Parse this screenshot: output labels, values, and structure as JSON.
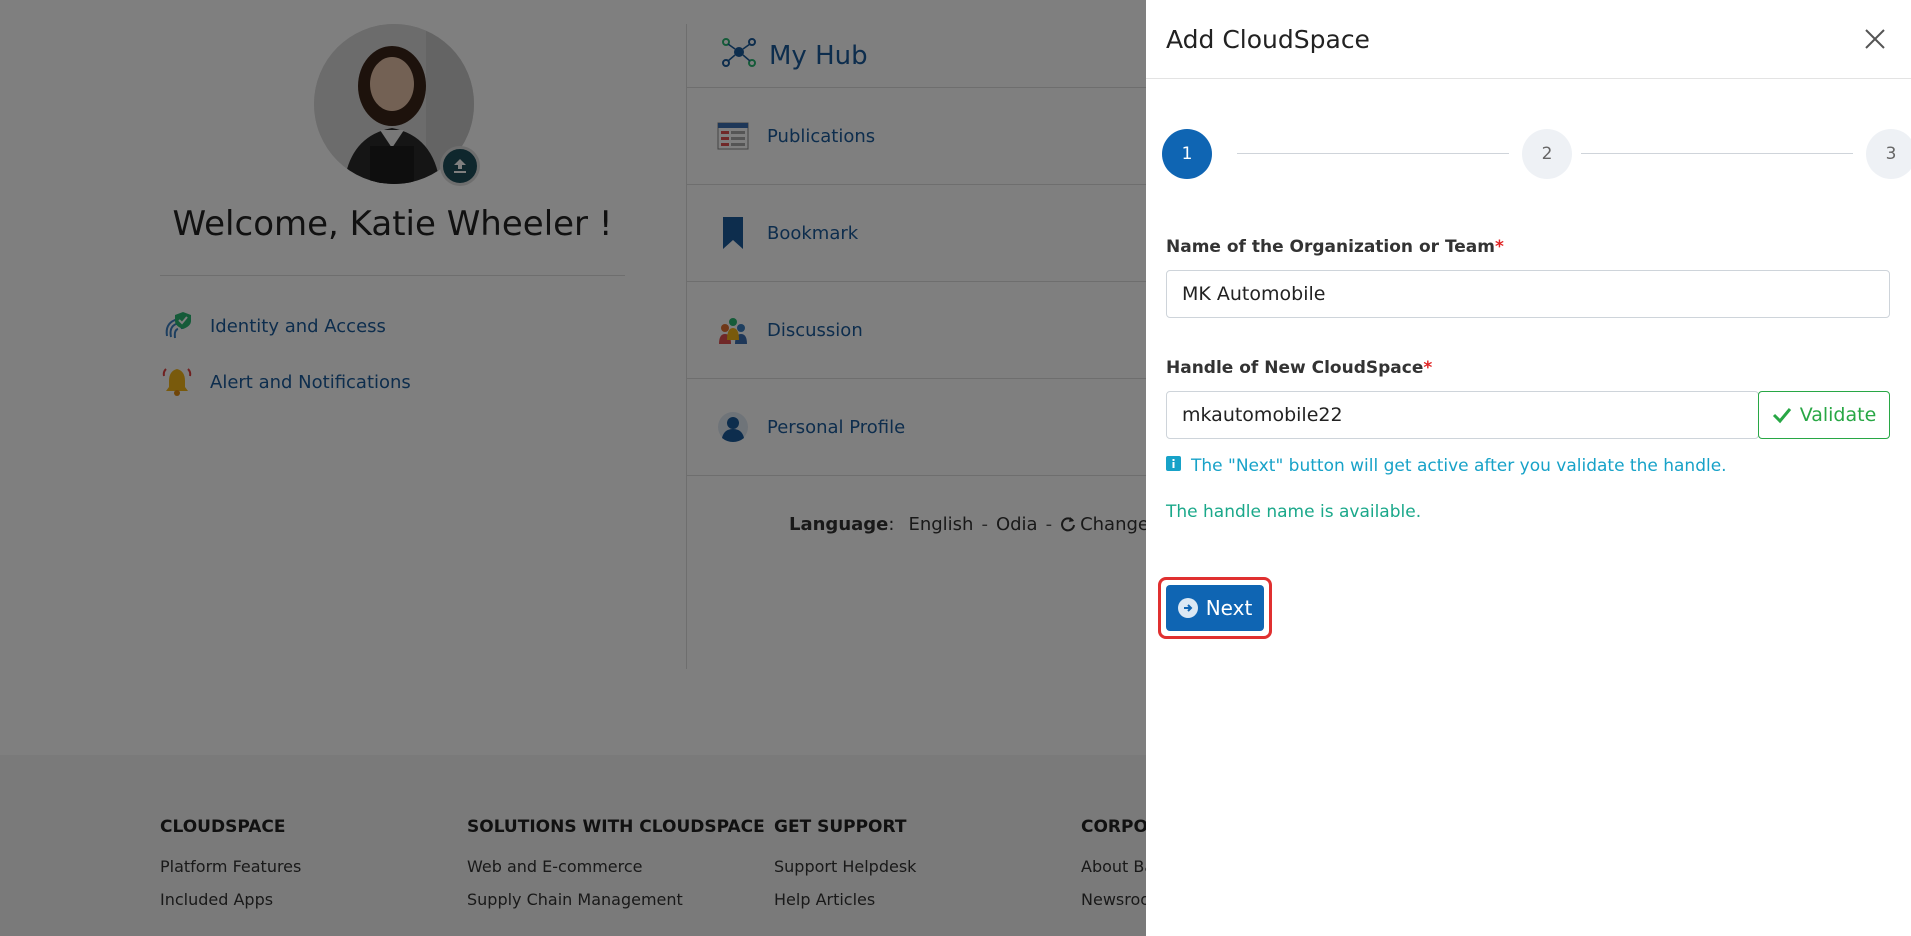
{
  "background": {
    "welcome_text": "Welcome, Katie Wheeler !",
    "quick_links": [
      {
        "label": "Identity and Access",
        "icon": "fingerprint-shield-icon"
      },
      {
        "label": "Alert and Notifications",
        "icon": "bell-icon"
      }
    ],
    "hub": {
      "title": "My Hub",
      "items": [
        {
          "label": "Publications",
          "icon": "publications-icon"
        },
        {
          "label": "Bookmark",
          "icon": "bookmark-icon"
        },
        {
          "label": "Discussion",
          "icon": "discussion-icon"
        },
        {
          "label": "Personal Profile",
          "icon": "person-icon"
        }
      ]
    },
    "language": {
      "label": "Language",
      "options": [
        "English",
        "Odia"
      ],
      "change_label": "Change"
    },
    "footer": {
      "columns": [
        {
          "heading": "CLOUDSPACE",
          "links": [
            "Platform Features",
            "Included Apps"
          ]
        },
        {
          "heading": "SOLUTIONS WITH CLOUDSPACE",
          "links": [
            "Web and E-commerce",
            "Supply Chain Management"
          ]
        },
        {
          "heading": "GET SUPPORT",
          "links": [
            "Support Helpdesk",
            "Help Articles"
          ]
        },
        {
          "heading": "CORPO",
          "links": [
            "About Ba",
            "Newsroo"
          ]
        }
      ]
    }
  },
  "panel": {
    "title": "Add CloudSpace",
    "steps": [
      "1",
      "2",
      "3"
    ],
    "active_step": 1,
    "org_field": {
      "label": "Name of the Organization or Team",
      "required_mark": "*",
      "value": "MK Automobile"
    },
    "handle_field": {
      "label": "Handle of New CloudSpace",
      "required_mark": "*",
      "value": "mkautomobile22"
    },
    "validate_label": "Validate",
    "info_text": "The \"Next\" button will get active after you validate the handle.",
    "availability_text": "The handle name is available.",
    "next_label": "Next"
  },
  "colors": {
    "primary": "#0f65b3",
    "success": "#28a745",
    "info": "#17a2c8",
    "available": "#1aa88a",
    "required": "#e02424",
    "highlight": "#e03030"
  }
}
